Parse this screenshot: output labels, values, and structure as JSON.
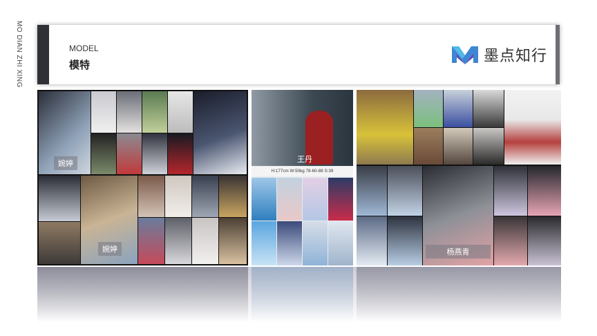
{
  "side_label": "MO DIAN ZHI XING",
  "header": {
    "label_en": "MODEL",
    "label_cn": "模特",
    "logo_text": "墨点知行",
    "logo_icon": "m-logo-icon",
    "accent_color": "#2f3136",
    "logo_colors": [
      "#3f86d4",
      "#5a4fb3",
      "#56c3e8"
    ]
  },
  "panels": [
    {
      "caption_1": "婉婷",
      "caption_2": "婉婷"
    },
    {
      "caption": "王丹",
      "stats": "H:177cm   W:50kg   78-60-88   S:39"
    },
    {
      "caption": "杨燕青"
    }
  ]
}
